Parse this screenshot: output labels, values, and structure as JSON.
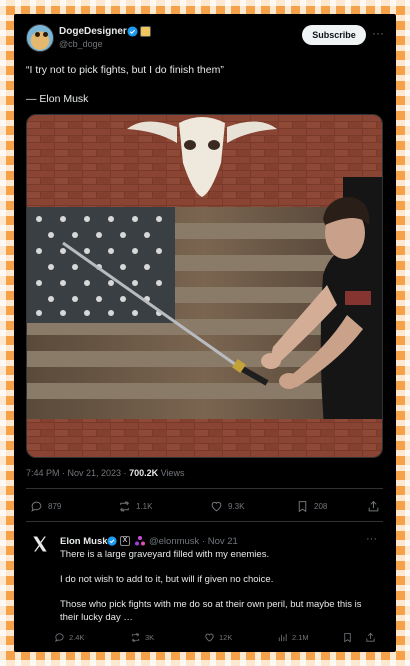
{
  "tweet": {
    "author_name": "DogeDesigner",
    "author_handle": "@cb_doge",
    "subscribe_label": "Subscribe",
    "more_label": "···",
    "quote": "“I try not to pick fights, but I do finish them”",
    "attribution": "— Elon Musk",
    "time": "7:44 PM · Nov 21, 2023 · ",
    "views_count": "700.2K",
    "views_label": " Views",
    "stats": {
      "replies": "879",
      "reposts": "1.1K",
      "likes": "9.3K",
      "bookmarks": "208"
    }
  },
  "quoted": {
    "name": "Elon Musk",
    "x_badge": "X",
    "handle": "@elonmusk · Nov 21",
    "more_label": "···",
    "lines": [
      "There is a large graveyard filled with my enemies.",
      "I do not wish to add to it, but will if given no choice.",
      "Those who pick fights with me do so at their own peril, but maybe this is their lucky day …"
    ],
    "stats": {
      "replies": "2.4K",
      "reposts": "3K",
      "likes": "12K",
      "views": "2.1M"
    }
  },
  "colors": {
    "background": "#000000",
    "frame_dashes": "#f6a24a",
    "verified": "#1d9bf0",
    "muted": "#71767b"
  }
}
